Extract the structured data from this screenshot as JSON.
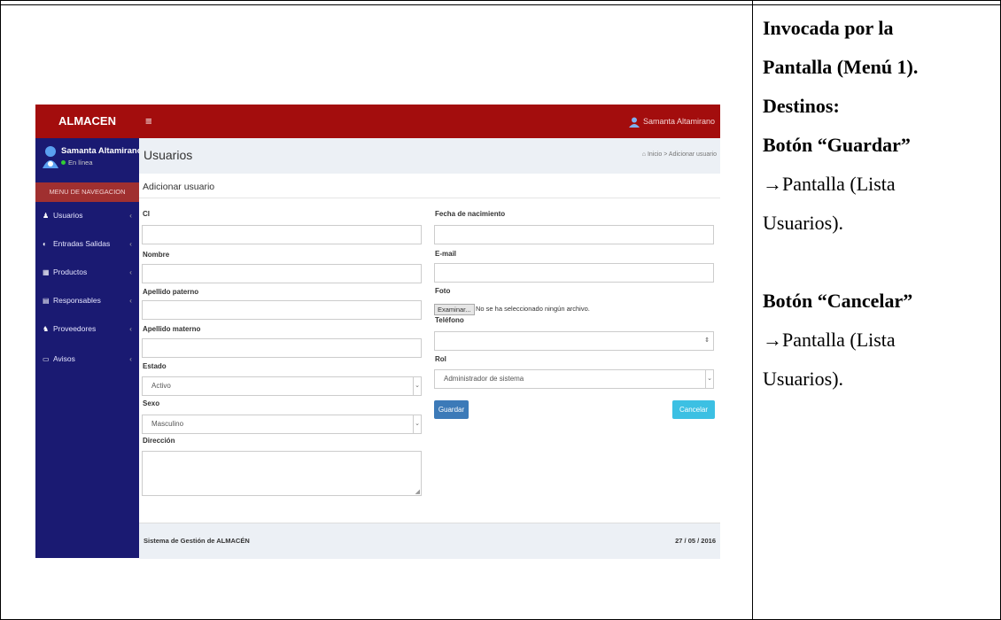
{
  "notes": {
    "invoked_line1": "Invocada por la",
    "invoked_line2": "Pantalla (Menú 1).",
    "destinos": "Destinos:",
    "guardar_title": "Botón “Guardar”",
    "guardar_dest1": "→Pantalla (Lista",
    "guardar_dest2": "Usuarios).",
    "cancelar_title": "Botón “Cancelar”",
    "cancelar_dest1": "→Pantalla (Lista",
    "cancelar_dest2": "Usuarios)."
  },
  "app": {
    "brand": "ALMACEN",
    "menu_icon": "hamburger-icon",
    "top_user": "Samanta Altamirano",
    "sidebar": {
      "user_name": "Samanta Altamirano",
      "user_status": "En línea",
      "nav_header": "MENU DE NAVEGACION",
      "items": [
        {
          "icon": "user-icon",
          "label": "Usuarios"
        },
        {
          "icon": "exchange-icon",
          "label": "Entradas Salidas"
        },
        {
          "icon": "box-icon",
          "label": "Productos"
        },
        {
          "icon": "list-icon",
          "label": "Responsables"
        },
        {
          "icon": "truck-icon",
          "label": "Proveedores"
        },
        {
          "icon": "bell-icon",
          "label": "Avisos"
        }
      ]
    },
    "header": {
      "title": "Usuarios",
      "breadcrumb_home": "Inicio",
      "breadcrumb_sep": ">",
      "breadcrumb_current": "Adicionar usuario"
    },
    "form": {
      "title": "Adicionar usuario",
      "ci_label": "CI",
      "nombre_label": "Nombre",
      "apellido_paterno_label": "Apellido paterno",
      "apellido_materno_label": "Apellido materno",
      "estado_label": "Estado",
      "estado_value": "Activo",
      "sexo_label": "Sexo",
      "sexo_value": "Masculino",
      "direccion_label": "Dirección",
      "fecha_label": "Fecha de nacimiento",
      "email_label": "E-mail",
      "foto_label": "Foto",
      "examinar_label": "Examinar...",
      "no_file_text": "No se ha seleccionado ningún archivo.",
      "telefono_label": "Teléfono",
      "rol_label": "Rol",
      "rol_value": "Administrador de sistema",
      "guardar_label": "Guardar",
      "cancelar_label": "Cancelar"
    },
    "footer": {
      "left": "Sistema de Gestión de ALMACÉN",
      "right": "27 / 05 / 2016"
    }
  }
}
